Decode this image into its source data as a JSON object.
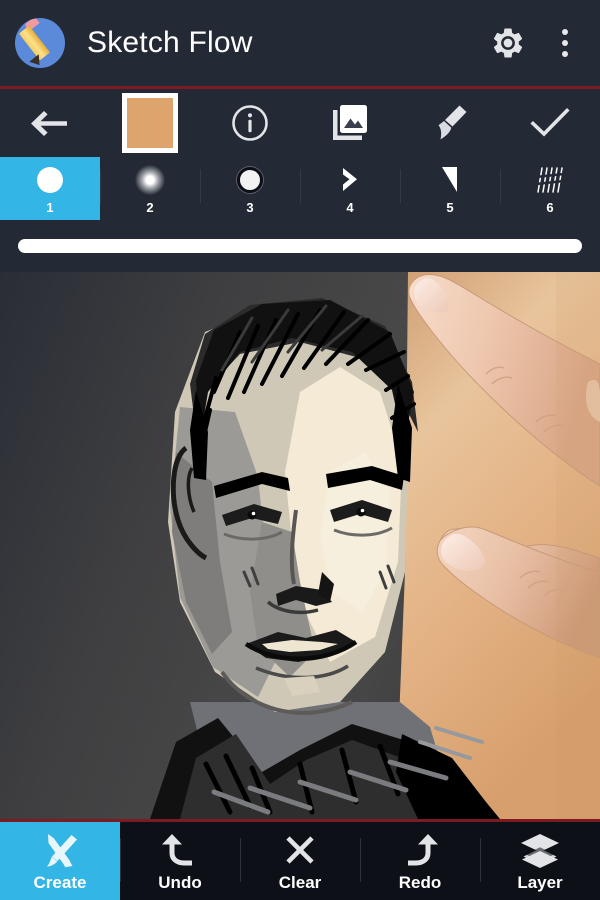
{
  "header": {
    "title": "Sketch Flow",
    "app_icon": "pencil-circle-icon",
    "settings_icon": "gear-icon",
    "overflow_icon": "kebab-menu-icon"
  },
  "toolbar": {
    "items": [
      {
        "name": "back-button",
        "icon": "arrow-left-icon"
      },
      {
        "name": "color-swatch",
        "icon": "color-swatch-icon",
        "color": "#dda56d"
      },
      {
        "name": "info-button",
        "icon": "info-circle-icon"
      },
      {
        "name": "gallery-button",
        "icon": "image-stack-icon"
      },
      {
        "name": "brush-button",
        "icon": "paintbrush-icon"
      },
      {
        "name": "confirm-button",
        "icon": "checkmark-icon"
      }
    ]
  },
  "brush_row": {
    "selected_index": 0,
    "selected_color": "#33b5e5",
    "brushes": [
      {
        "number": "1",
        "glyph": "hard-round-brush-icon"
      },
      {
        "number": "2",
        "glyph": "soft-round-brush-icon"
      },
      {
        "number": "3",
        "glyph": "outlined-round-brush-icon"
      },
      {
        "number": "4",
        "glyph": "chevron-brush-icon"
      },
      {
        "number": "5",
        "glyph": "wedge-brush-icon"
      },
      {
        "number": "6",
        "glyph": "hatching-brush-icon"
      }
    ]
  },
  "size_slider": {
    "name": "brush-size-slider",
    "track_color": "#ffffff",
    "value_percent": 100
  },
  "canvas": {
    "name": "drawing-canvas",
    "content": "grayscale posterized sketch portrait of a man with a hand touching the screen",
    "background_left_color": "#3d3d3d",
    "background_right_color": "#e0b081"
  },
  "bottom_bar": {
    "active_index": 0,
    "active_color": "#33b5e5",
    "items": [
      {
        "label": "Create",
        "icon": "pencil-brush-cross-icon"
      },
      {
        "label": "Undo",
        "icon": "undo-arrow-icon"
      },
      {
        "label": "Clear",
        "icon": "close-x-icon"
      },
      {
        "label": "Redo",
        "icon": "redo-arrow-icon"
      },
      {
        "label": "Layer",
        "icon": "layers-stack-icon"
      }
    ]
  },
  "accents": {
    "rule_color": "#7d1a22",
    "chrome_bg": "#242936",
    "bottom_bg": "#0d1017"
  }
}
